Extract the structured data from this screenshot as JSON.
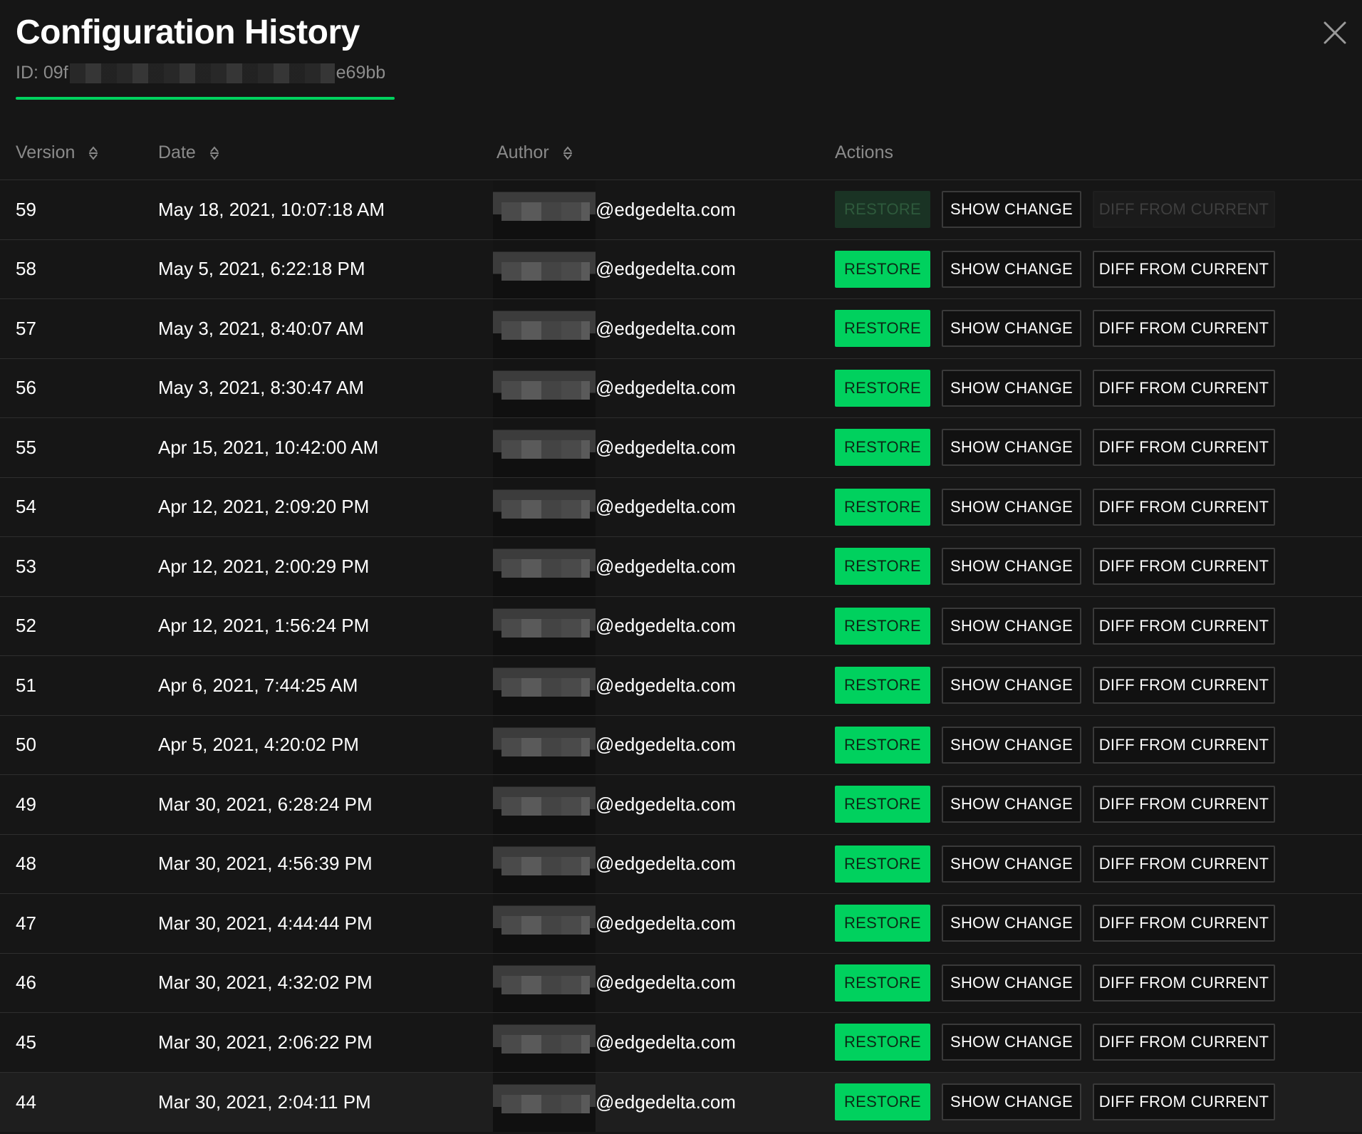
{
  "header": {
    "title": "Configuration History",
    "id_prefix": "ID: 09f",
    "id_suffix": "e69bb"
  },
  "columns": {
    "version": "Version",
    "date": "Date",
    "author": "Author",
    "actions": "Actions"
  },
  "button_labels": {
    "restore": "RESTORE",
    "show_change": "SHOW CHANGE",
    "diff_from_current": "DIFF FROM CURRENT"
  },
  "colors": {
    "accent": "#00d15e",
    "background": "#161616"
  },
  "rows": [
    {
      "version": "59",
      "date": "May 18, 2021, 10:07:18 AM",
      "author": "@edgedelta.com",
      "current": true
    },
    {
      "version": "58",
      "date": "May 5, 2021, 6:22:18 PM",
      "author": "@edgedelta.com",
      "current": false
    },
    {
      "version": "57",
      "date": "May 3, 2021, 8:40:07 AM",
      "author": "@edgedelta.com",
      "current": false
    },
    {
      "version": "56",
      "date": "May 3, 2021, 8:30:47 AM",
      "author": "@edgedelta.com",
      "current": false
    },
    {
      "version": "55",
      "date": "Apr 15, 2021, 10:42:00 AM",
      "author": "@edgedelta.com",
      "current": false
    },
    {
      "version": "54",
      "date": "Apr 12, 2021, 2:09:20 PM",
      "author": "@edgedelta.com",
      "current": false
    },
    {
      "version": "53",
      "date": "Apr 12, 2021, 2:00:29 PM",
      "author": "@edgedelta.com",
      "current": false
    },
    {
      "version": "52",
      "date": "Apr 12, 2021, 1:56:24 PM",
      "author": "@edgedelta.com",
      "current": false
    },
    {
      "version": "51",
      "date": "Apr 6, 2021, 7:44:25 AM",
      "author": "@edgedelta.com",
      "current": false
    },
    {
      "version": "50",
      "date": "Apr 5, 2021, 4:20:02 PM",
      "author": "@edgedelta.com",
      "current": false
    },
    {
      "version": "49",
      "date": "Mar 30, 2021, 6:28:24 PM",
      "author": "@edgedelta.com",
      "current": false
    },
    {
      "version": "48",
      "date": "Mar 30, 2021, 4:56:39 PM",
      "author": "@edgedelta.com",
      "current": false
    },
    {
      "version": "47",
      "date": "Mar 30, 2021, 4:44:44 PM",
      "author": "@edgedelta.com",
      "current": false
    },
    {
      "version": "46",
      "date": "Mar 30, 2021, 4:32:02 PM",
      "author": "@edgedelta.com",
      "current": false
    },
    {
      "version": "45",
      "date": "Mar 30, 2021, 2:06:22 PM",
      "author": "@edgedelta.com",
      "current": false
    },
    {
      "version": "44",
      "date": "Mar 30, 2021, 2:04:11 PM",
      "author": "@edgedelta.com",
      "current": false
    }
  ]
}
